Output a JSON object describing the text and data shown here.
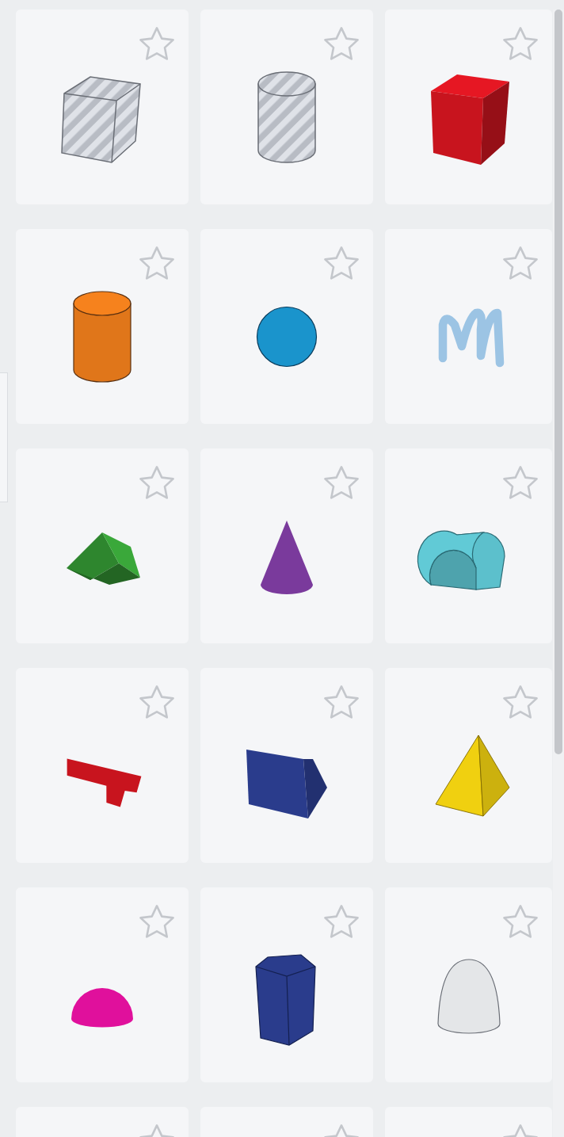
{
  "shapes": [
    {
      "kind": "box-hole",
      "color": "#b8bcc4",
      "favorite": false
    },
    {
      "kind": "cylinder-hole",
      "color": "#b8bcc4",
      "favorite": false
    },
    {
      "kind": "box",
      "color": "#c8141e",
      "favorite": false
    },
    {
      "kind": "cylinder",
      "color": "#e0761a",
      "favorite": false
    },
    {
      "kind": "sphere",
      "color": "#1a94cc",
      "favorite": false
    },
    {
      "kind": "scribble",
      "color": "#9cc4e4",
      "favorite": false
    },
    {
      "kind": "roof",
      "color": "#3aa83a",
      "favorite": false
    },
    {
      "kind": "cone",
      "color": "#7a3a9c",
      "favorite": false
    },
    {
      "kind": "round-roof",
      "color": "#5cc0cc",
      "favorite": false
    },
    {
      "kind": "text",
      "color": "#c8141e",
      "favorite": false
    },
    {
      "kind": "wedge",
      "color": "#2a3c8c",
      "favorite": false
    },
    {
      "kind": "pyramid",
      "color": "#f0d010",
      "favorite": false
    },
    {
      "kind": "half-sphere",
      "color": "#e0109c",
      "favorite": false
    },
    {
      "kind": "polygon",
      "color": "#2a3c8c",
      "favorite": false
    },
    {
      "kind": "paraboloid",
      "color": "#e4e6e8",
      "favorite": false
    },
    {
      "kind": "unknown",
      "favorite": false
    },
    {
      "kind": "unknown",
      "favorite": false
    },
    {
      "kind": "unknown",
      "favorite": false
    }
  ]
}
